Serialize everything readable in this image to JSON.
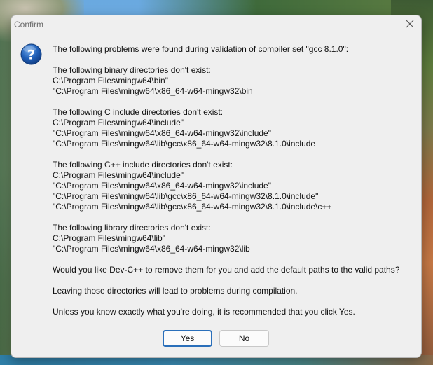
{
  "window": {
    "title": "Confirm"
  },
  "icons": {
    "dialog": "question-icon",
    "close": "close-icon"
  },
  "message": {
    "intro": "The following problems were found during validation of compiler set \"gcc 8.1.0\":",
    "sections": [
      {
        "heading": "The following binary directories don't exist:",
        "paths": [
          "C:\\Program Files\\mingw64\\bin\"",
          "\"C:\\Program Files\\mingw64\\x86_64-w64-mingw32\\bin"
        ]
      },
      {
        "heading": "The following C include directories don't exist:",
        "paths": [
          "C:\\Program Files\\mingw64\\include\"",
          "\"C:\\Program Files\\mingw64\\x86_64-w64-mingw32\\include\"",
          "\"C:\\Program Files\\mingw64\\lib\\gcc\\x86_64-w64-mingw32\\8.1.0\\include"
        ]
      },
      {
        "heading": "The following C++ include directories don't exist:",
        "paths": [
          "C:\\Program Files\\mingw64\\include\"",
          "\"C:\\Program Files\\mingw64\\x86_64-w64-mingw32\\include\"",
          "\"C:\\Program Files\\mingw64\\lib\\gcc\\x86_64-w64-mingw32\\8.1.0\\include\"",
          "\"C:\\Program Files\\mingw64\\lib\\gcc\\x86_64-w64-mingw32\\8.1.0\\include\\c++"
        ]
      },
      {
        "heading": "The following library directories don't exist:",
        "paths": [
          "C:\\Program Files\\mingw64\\lib\"",
          "\"C:\\Program Files\\mingw64\\x86_64-w64-mingw32\\lib"
        ]
      }
    ],
    "question": "Would you like Dev-C++ to remove them for you and add the default paths to the valid paths?",
    "warning": "Leaving those directories will lead to problems during compilation.",
    "recommendation": "Unless you know exactly what you're doing, it is recommended that you click Yes."
  },
  "buttons": {
    "yes": "Yes",
    "no": "No"
  },
  "colors": {
    "accent": "#2a6fba",
    "dialog_bg": "#efefef"
  }
}
